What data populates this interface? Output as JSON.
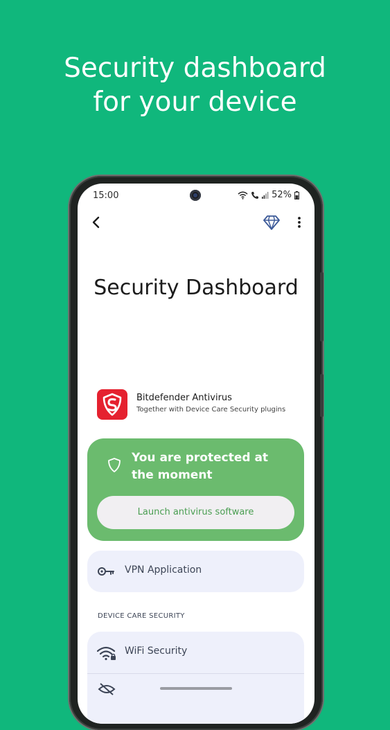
{
  "promo": {
    "headline_line1": "Security dashboard",
    "headline_line2": "for your device"
  },
  "status_bar": {
    "time": "15:00",
    "battery": "52%",
    "icons": [
      "wifi-icon",
      "wifi-calling-icon",
      "signal-icon",
      "battery-icon"
    ]
  },
  "app_bar": {
    "back_icon": "back-arrow-icon",
    "premium_icon": "diamond-icon",
    "more_icon": "more-vertical-icon"
  },
  "page": {
    "title": "Security Dashboard"
  },
  "app_info": {
    "name": "Bitdefender Antivirus",
    "subtitle": "Together with Device Care Security plugins",
    "logo_icon": "bitdefender-logo"
  },
  "protection": {
    "status": "You are protected at the moment",
    "launch_label": "Launch antivirus software",
    "color": "#6bbb6e",
    "button_text_color": "#4a9e52"
  },
  "vpn": {
    "label": "VPN Application",
    "icon": "key-icon"
  },
  "device_care": {
    "section_label": "DEVICE CARE SECURITY",
    "items": [
      {
        "label": "WiFi Security",
        "icon": "wifi-lock-icon"
      }
    ]
  },
  "colors": {
    "background": "#10b77c",
    "card": "#eef0fb",
    "brand_red": "#e5212f"
  }
}
